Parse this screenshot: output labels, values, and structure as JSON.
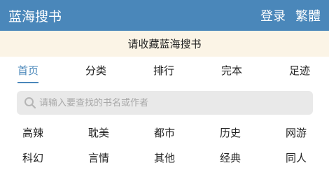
{
  "header": {
    "brand": "蓝海搜书",
    "login": "登录",
    "traditional": "繁體"
  },
  "notice": "请收藏蓝海搜书",
  "nav": {
    "items": [
      {
        "label": "首页",
        "active": true
      },
      {
        "label": "分类",
        "active": false
      },
      {
        "label": "排行",
        "active": false
      },
      {
        "label": "完本",
        "active": false
      },
      {
        "label": "足迹",
        "active": false
      }
    ]
  },
  "search": {
    "placeholder": "请输入要查找的书名或作者",
    "icon": "search-icon"
  },
  "categories": {
    "row1": [
      "高辣",
      "耽美",
      "都市",
      "历史",
      "网游"
    ],
    "row2": [
      "科幻",
      "言情",
      "其他",
      "经典",
      "同人"
    ]
  },
  "colors": {
    "header_bg": "#4a87ba",
    "notice_bg": "#fbf4e6",
    "accent": "#4a87ba",
    "search_bg": "#e9e9e9"
  }
}
